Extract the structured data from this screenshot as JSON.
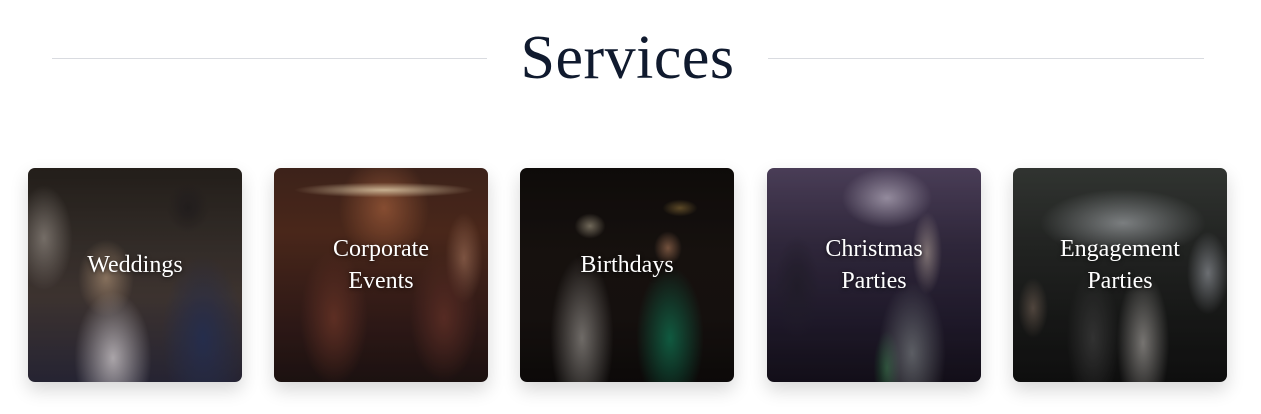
{
  "section": {
    "title": "Services"
  },
  "services": [
    {
      "label": "Weddings"
    },
    {
      "label": "Corporate\nEvents"
    },
    {
      "label": "Birthdays"
    },
    {
      "label": "Christmas\nParties"
    },
    {
      "label": "Engagement\nParties"
    }
  ],
  "colors": {
    "title": "#101a2e",
    "rule": "#d9dbe0",
    "card_text": "#ffffff"
  }
}
